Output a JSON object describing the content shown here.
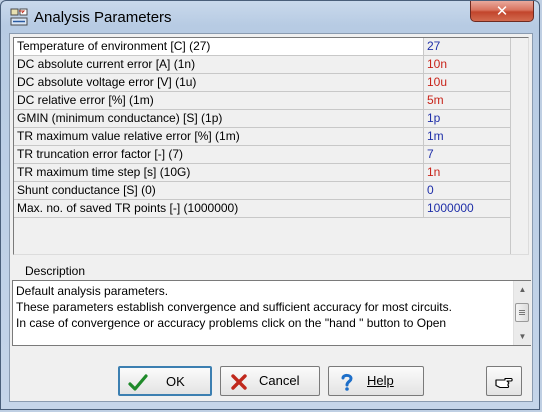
{
  "window": {
    "title": "Analysis Parameters",
    "close_label": "✕"
  },
  "parameters": [
    {
      "name": "Temperature of environment [C]  (27)",
      "value": "27",
      "color": "#1f2fa8"
    },
    {
      "name": "DC absolute current error [A]  (1n)",
      "value": "10n",
      "color": "#c8241a"
    },
    {
      "name": "DC absolute voltage error [V]  (1u)",
      "value": "10u",
      "color": "#c8241a"
    },
    {
      "name": "DC relative error [%]  (1m)",
      "value": "5m",
      "color": "#c8241a"
    },
    {
      "name": "GMIN (minimum conductance) [S]  (1p)",
      "value": "1p",
      "color": "#1f2fa8"
    },
    {
      "name": "TR maximum value relative error [%]  (1m)",
      "value": "1m",
      "color": "#1f2fa8"
    },
    {
      "name": "TR truncation error factor [-]  (7)",
      "value": "7",
      "color": "#1f2fa8"
    },
    {
      "name": "TR maximum time step [s]  (10G)",
      "value": "1n",
      "color": "#c8241a"
    },
    {
      "name": "Shunt conductance [S]  (0)",
      "value": "0",
      "color": "#1f2fa8"
    },
    {
      "name": "Max. no. of saved TR points [-]  (1000000)",
      "value": "1000000",
      "color": "#1f2fa8"
    }
  ],
  "description": {
    "label": "Description",
    "lines": [
      "Default analysis parameters.",
      "These parameters establish convergence and sufficient accuracy for most circuits.",
      "In case of convergence or accuracy problems click on the \"hand \" button to Open"
    ]
  },
  "buttons": {
    "ok": "OK",
    "cancel": "Cancel",
    "help": "Help"
  },
  "icons": {
    "app": "analysis-app-icon",
    "ok": "checkmark-icon",
    "cancel": "x-mark-icon",
    "help": "question-mark-icon",
    "hand": "pointing-hand-icon"
  }
}
